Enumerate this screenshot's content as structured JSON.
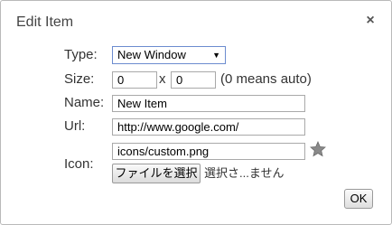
{
  "dialog": {
    "title": "Edit Item",
    "close_label": "×"
  },
  "form": {
    "type": {
      "label": "Type:",
      "selected": "New Window",
      "arrow": "▼"
    },
    "size": {
      "label": "Size:",
      "width_value": "0",
      "separator": "x",
      "height_value": "0",
      "hint": "(0 means auto)"
    },
    "name": {
      "label": "Name:",
      "value": "New Item"
    },
    "url": {
      "label": "Url:",
      "value": "http://www.google.com/"
    },
    "icon": {
      "label": "Icon:",
      "value": "icons/custom.png",
      "preview_icon": "star-icon",
      "file_button_label": "ファイルを選択",
      "file_status": "選択さ...ません"
    }
  },
  "footer": {
    "ok_label": "OK"
  },
  "colors": {
    "dialog_border": "#b9b9b9",
    "select_border": "#6c8ccf",
    "star_fill": "#8a8a8a"
  }
}
